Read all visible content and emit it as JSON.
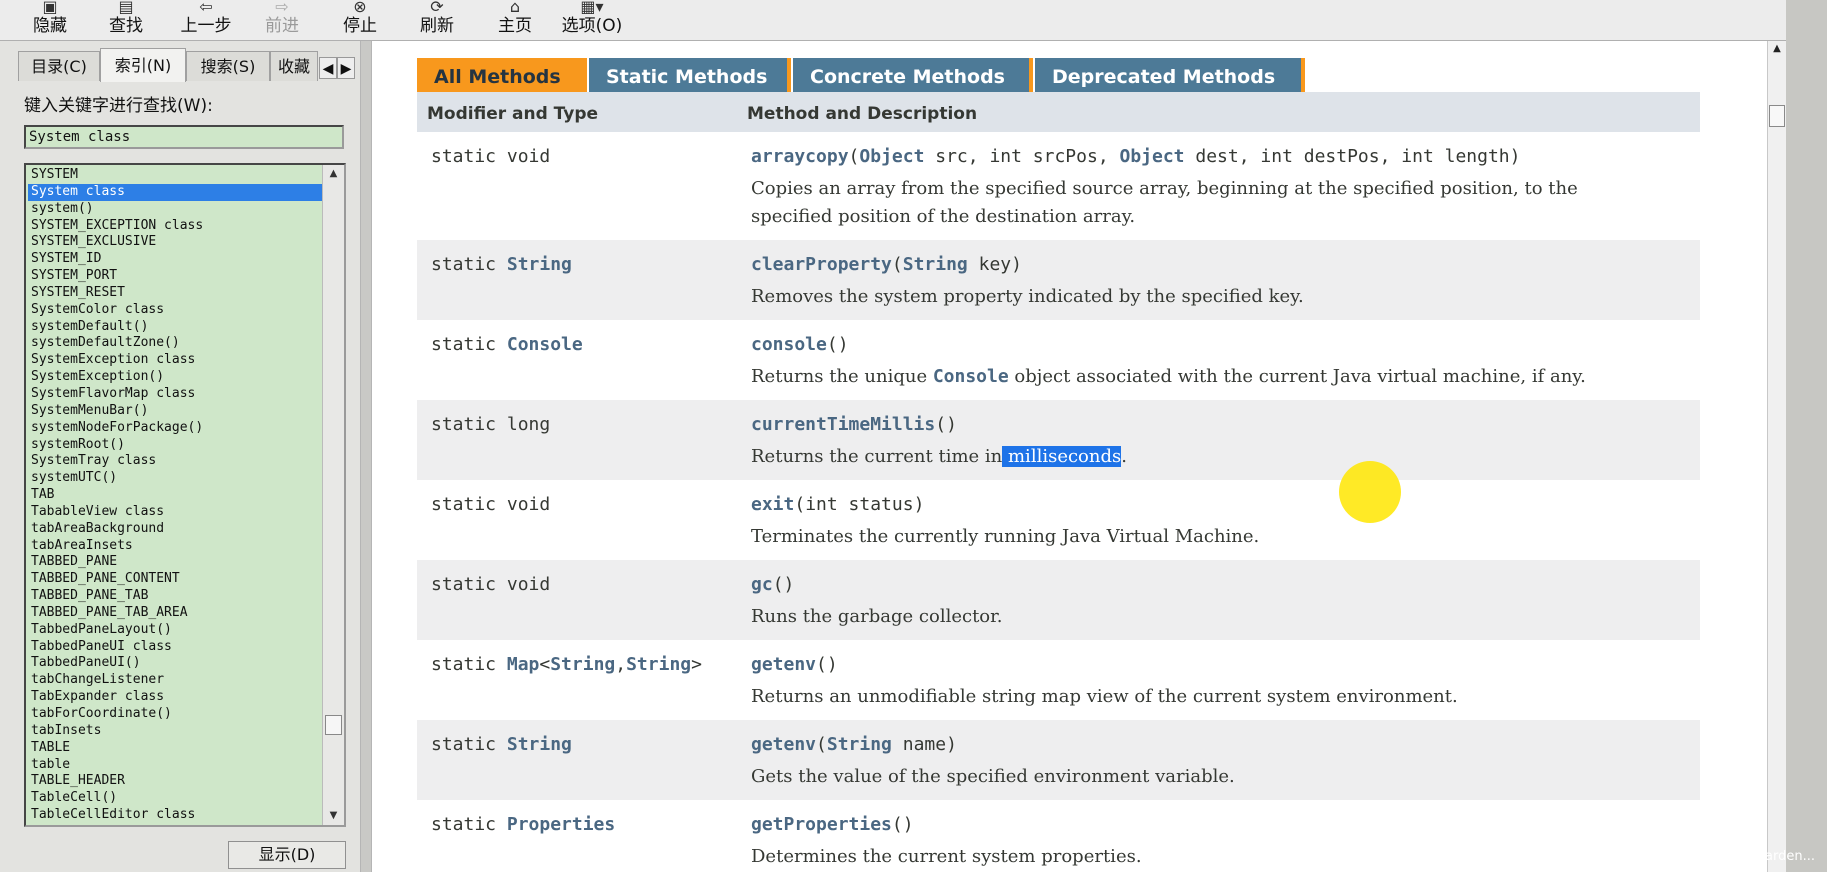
{
  "toolbar": {
    "buttons": [
      {
        "label": "隐藏",
        "icon": "hide-icon"
      },
      {
        "label": "查找",
        "icon": "find-icon"
      },
      {
        "label": "上一步",
        "icon": "back-icon"
      },
      {
        "label": "前进",
        "icon": "forward-icon",
        "disabled": true
      },
      {
        "label": "停止",
        "icon": "stop-icon"
      },
      {
        "label": "刷新",
        "icon": "refresh-icon"
      },
      {
        "label": "主页",
        "icon": "home-icon"
      },
      {
        "label": "选项(O)",
        "icon": "options-icon"
      }
    ]
  },
  "left_pane": {
    "tabs": [
      "目录(C)",
      "索引(N)",
      "搜索(S)",
      "收藏"
    ],
    "active_tab": "索引(N)",
    "keyword_label": "键入关键字进行查找(W):",
    "keyword_value": "System class",
    "index_items": [
      "SYSTEM",
      "System class",
      "system()",
      "SYSTEM_EXCEPTION class",
      "SYSTEM_EXCLUSIVE",
      "SYSTEM_ID",
      "SYSTEM_PORT",
      "SYSTEM_RESET",
      "SystemColor class",
      "systemDefault()",
      "systemDefaultZone()",
      "SystemException class",
      "SystemException()",
      "SystemFlavorMap class",
      "SystemMenuBar()",
      "systemNodeForPackage()",
      "systemRoot()",
      "SystemTray class",
      "systemUTC()",
      "TAB",
      "TabableView class",
      "tabAreaBackground",
      "tabAreaInsets",
      "TABBED_PANE",
      "TABBED_PANE_CONTENT",
      "TABBED_PANE_TAB",
      "TABBED_PANE_TAB_AREA",
      "TabbedPaneLayout()",
      "TabbedPaneUI class",
      "TabbedPaneUI()",
      "tabChangeListener",
      "TabExpander class",
      "tabForCoordinate()",
      "tabInsets",
      "TABLE",
      "table",
      "TABLE_HEADER",
      "TableCell()",
      "TableCellEditor class"
    ],
    "selected_item": "System class",
    "display_button": "显示(D)"
  },
  "doc": {
    "method_tabs": [
      "All Methods",
      "Static Methods",
      "Concrete Methods",
      "Deprecated Methods"
    ],
    "active_method_tab": "All Methods",
    "col_headers": {
      "modifier": "Modifier and Type",
      "method": "Method and Description"
    },
    "methods": [
      {
        "modifier": "static void",
        "signature": "arraycopy(Object src, int srcPos, Object dest, int destPos, int length)",
        "description": "Copies an array from the specified source array, beginning at the specified position, to the specified position of the destination array."
      },
      {
        "modifier": "static String",
        "signature": "clearProperty(String key)",
        "description": "Removes the system property indicated by the specified key."
      },
      {
        "modifier": "static Console",
        "signature": "console()",
        "description": "Returns the unique Console object associated with the current Java virtual machine, if any."
      },
      {
        "modifier": "static long",
        "signature": "currentTimeMillis()",
        "description": "Returns the current time in milliseconds."
      },
      {
        "modifier": "static void",
        "signature": "exit(int status)",
        "description": "Terminates the currently running Java Virtual Machine."
      },
      {
        "modifier": "static void",
        "signature": "gc()",
        "description": "Runs the garbage collector."
      },
      {
        "modifier": "static Map<String,String>",
        "signature": "getenv()",
        "description": "Returns an unmodifiable string map view of the current system environment."
      },
      {
        "modifier": "static String",
        "signature": "getenv(String name)",
        "description": "Gets the value of the specified environment variable."
      },
      {
        "modifier": "static Properties",
        "signature": "getProperties()",
        "description": "Determines the current system properties."
      }
    ],
    "highlighted_text": "milliseconds"
  },
  "watermark": "CSDN @harden...",
  "colors": {
    "tab_active": "#f8981d",
    "tab_inactive": "#4d7a97",
    "header_bg": "#dee3e9",
    "row_alt": "#eeeeef",
    "link": "#4a6782",
    "list_bg": "#cfe7c9",
    "selection": "#2d7fe6"
  }
}
